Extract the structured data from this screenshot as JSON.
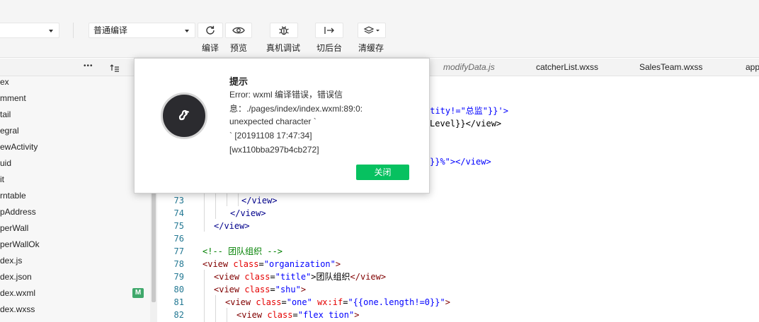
{
  "toolbar": {
    "left_select_value": "",
    "mode_select_value": "普通编译",
    "buttons": {
      "compile": "编译",
      "preview": "预览",
      "debug": "真机调试",
      "background": "切后台",
      "clear_cache": "清缓存"
    }
  },
  "tree_header": {
    "more": "•••",
    "sort": ""
  },
  "file_tree": [
    "ex",
    "mment",
    "tail",
    "egral",
    "ewActivity",
    "uid",
    "it",
    "rntable",
    "pAddress",
    "perWall",
    "perWallOk",
    "dex.js",
    "dex.json",
    "dex.wxml",
    "dex.wxss"
  ],
  "file_badge": "M",
  "tabs": {
    "modify": "modifyData.js",
    "catcher": "catcherList.wxss",
    "sales": "SalesTeam.wxss",
    "app": "app"
  },
  "code": {
    "line_numbers": [
      "73",
      "74",
      "75",
      "76",
      "77",
      "78",
      "79",
      "80",
      "81",
      "82"
    ],
    "upper_1": "ntity!=\"总监\"}}'>",
    "upper_2": "Level}}</view>",
    "upper_3": "}}%\"></view>",
    "l73": "</view>",
    "l74": "</view>",
    "l75": "</view>",
    "l77": "<!-- 团队组织 -->",
    "l78_tag": "<view ",
    "l78_attr": "class",
    "l78_eq": "=",
    "l78_val": "\"organization\"",
    "l78_end": ">",
    "l79_tag": "<view ",
    "l79_attr": "class",
    "l79_eq": "=",
    "l79_val": "\"title\"",
    "l79_mid": ">团队组织",
    "l79_end": "</view>",
    "l80_tag": "<view ",
    "l80_attr": "class",
    "l80_eq": "=",
    "l80_val": "\"shu\"",
    "l80_end": ">",
    "l81_tag": "<view ",
    "l81_attr": "class",
    "l81_eq": "=",
    "l81_val": "\"one\"",
    "l81_attr2": " wx:if",
    "l81_eq2": "=",
    "l81_val2": "\"{{one.length!=0}}\"",
    "l81_end": ">",
    "l82_tag": "<view ",
    "l82_attr": "class",
    "l82_eq": "=",
    "l82_val": "\"flex tion\"",
    "l82_end": ">"
  },
  "dialog": {
    "title": "提示",
    "lines": [
      "Error: wxml 编译错误，错误信",
      "息：./pages/index/index.wxml:89:0:",
      "unexpected character `",
      "` [20191108 17:47:34]",
      "[wx110bba297b4cb272]"
    ],
    "close_button": "关闭"
  },
  "colors": {
    "accent_green": "#07c160",
    "badge_green": "#3fa86b",
    "line_number": "#237893",
    "tag": "#800000",
    "attribute": "#e50000",
    "string": "#0000ff",
    "comment": "#008000"
  }
}
